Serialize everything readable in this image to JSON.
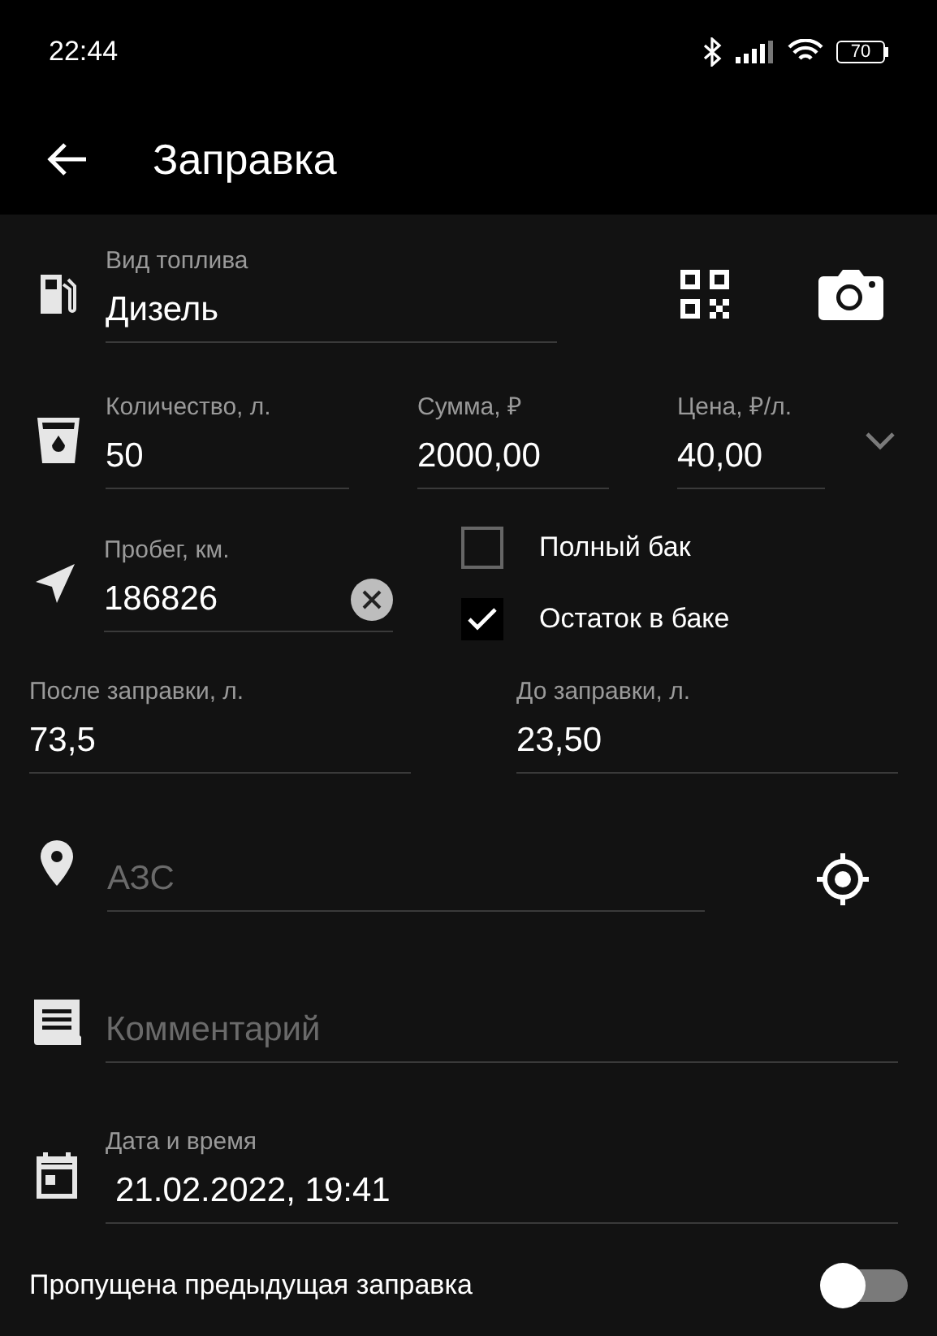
{
  "status_bar": {
    "time": "22:44",
    "battery": "70"
  },
  "app_bar": {
    "title": "Заправка"
  },
  "fuel_type": {
    "label": "Вид топлива",
    "value": "Дизель"
  },
  "amounts": [
    {
      "label": "Количество, л.",
      "value": "50"
    },
    {
      "label": "Сумма, ₽",
      "value": "2000,00"
    },
    {
      "label": "Цена, ₽/л.",
      "value": "40,00"
    }
  ],
  "mileage": {
    "label": "Пробег, км.",
    "value": "186826"
  },
  "checkboxes": [
    {
      "label": "Полный бак",
      "checked": false
    },
    {
      "label": "Остаток в баке",
      "checked": true
    }
  ],
  "tank": [
    {
      "label": "После заправки, л.",
      "value": "73,5"
    },
    {
      "label": "До заправки, л.",
      "value": "23,50"
    }
  ],
  "station": {
    "placeholder": "АЗС"
  },
  "comment": {
    "placeholder": "Комментарий"
  },
  "datetime": {
    "label": "Дата и время",
    "value": "21.02.2022, 19:41"
  },
  "skipped_refuel": {
    "label": "Пропущена предыдущая заправка",
    "on": false
  }
}
